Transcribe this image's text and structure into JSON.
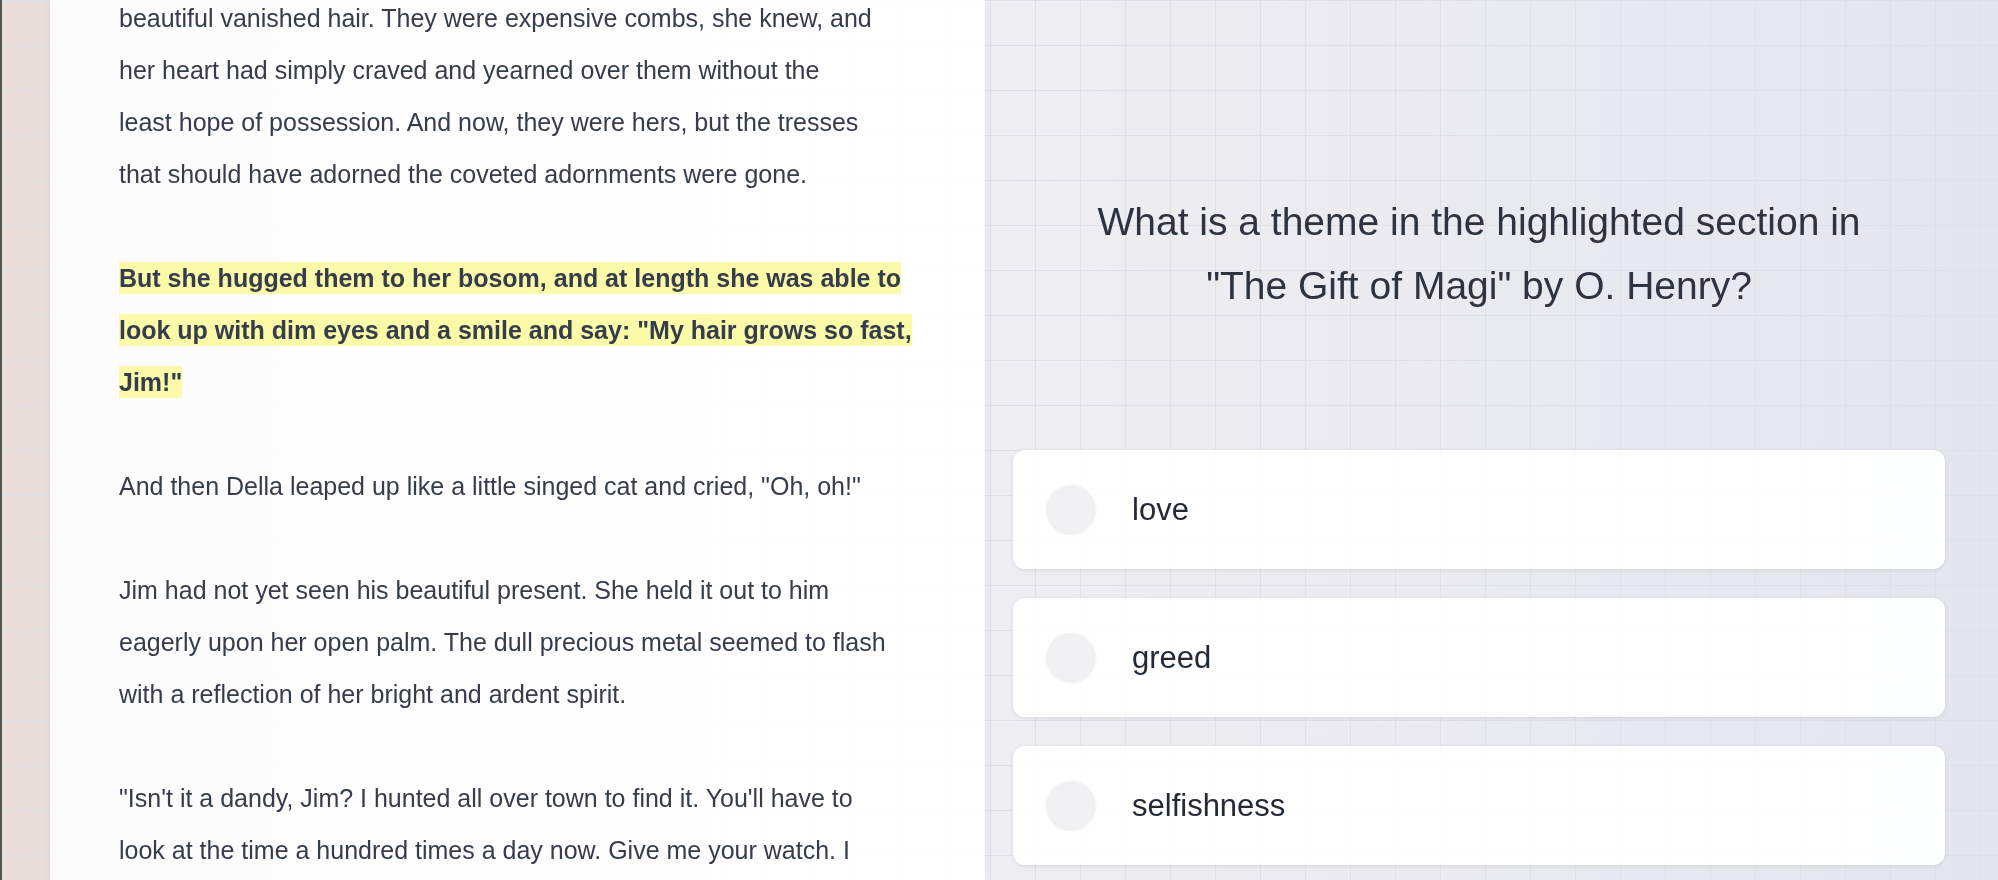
{
  "passage": [
    {
      "kind": "plain",
      "lines": [
        "beautiful vanished hair. They were expensive combs, she knew, and",
        "her heart had simply craved and yearned over them without the",
        "least hope of possession. And now, they were hers, but the tresses",
        "that should have adorned the coveted adornments were gone."
      ]
    },
    {
      "kind": "highlighted",
      "lines": [
        "But she hugged them to her bosom, and at length she was able to",
        "look up with dim eyes and a smile and say: \"My hair grows so fast,",
        "Jim!\""
      ]
    },
    {
      "kind": "plain",
      "lines": [
        "And then Della leaped up like a little singed cat and cried, \"Oh, oh!\""
      ]
    },
    {
      "kind": "plain",
      "lines": [
        "Jim had not yet seen his beautiful present. She held it out to him",
        "eagerly upon her open palm. The dull precious metal seemed to flash",
        "with a reflection of her bright and ardent spirit."
      ]
    },
    {
      "kind": "plain",
      "lines": [
        "\"Isn't it a dandy, Jim? I hunted all over town to find it. You'll have to",
        "look at the time a hundred times a day now. Give me your watch. I"
      ]
    }
  ],
  "question": "What is a theme in the highlighted section in \"The Gift of Magi\" by O. Henry?",
  "options": [
    {
      "label": "love",
      "selected": false
    },
    {
      "label": "greed",
      "selected": false
    },
    {
      "label": "selfishness",
      "selected": false
    }
  ]
}
